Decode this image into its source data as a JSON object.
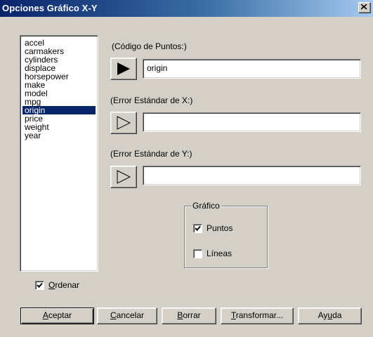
{
  "window": {
    "title": "Opciones Gráfico X-Y",
    "close_glyph": "x"
  },
  "variables": {
    "items": [
      "accel",
      "carmakers",
      "cylinders",
      "displace",
      "horsepower",
      "make",
      "model",
      "mpg",
      "origin",
      "price",
      "weight",
      "year"
    ],
    "selected": "origin"
  },
  "fields": {
    "point_code": {
      "label": "(Código de Puntos:)",
      "value": "origin"
    },
    "x_error": {
      "label": "(Error Estándar de X:)",
      "value": ""
    },
    "y_error": {
      "label": "(Error Estándar de Y:)",
      "value": ""
    }
  },
  "graph_group": {
    "title": "Gráfico",
    "points": {
      "label": "Puntos",
      "checked": true
    },
    "lines": {
      "label": "Líneas",
      "checked": false
    }
  },
  "sort": {
    "label": "Ordenar",
    "checked": true
  },
  "buttons": {
    "accept": {
      "u": "A",
      "rest": "ceptar"
    },
    "cancel": {
      "u": "C",
      "rest": "ancelar"
    },
    "clear": {
      "u": "B",
      "rest": "orrar"
    },
    "transform": {
      "u": "T",
      "rest": "ransformar..."
    },
    "help": {
      "pre": "Ay",
      "u": "u",
      "rest": "da"
    }
  },
  "colors": {
    "selection": "#0a246a",
    "face": "#d4d0c8"
  },
  "icons": {
    "arrow_active": "filled-right-triangle-icon",
    "arrow_inactive": "outline-right-triangle-icon"
  }
}
